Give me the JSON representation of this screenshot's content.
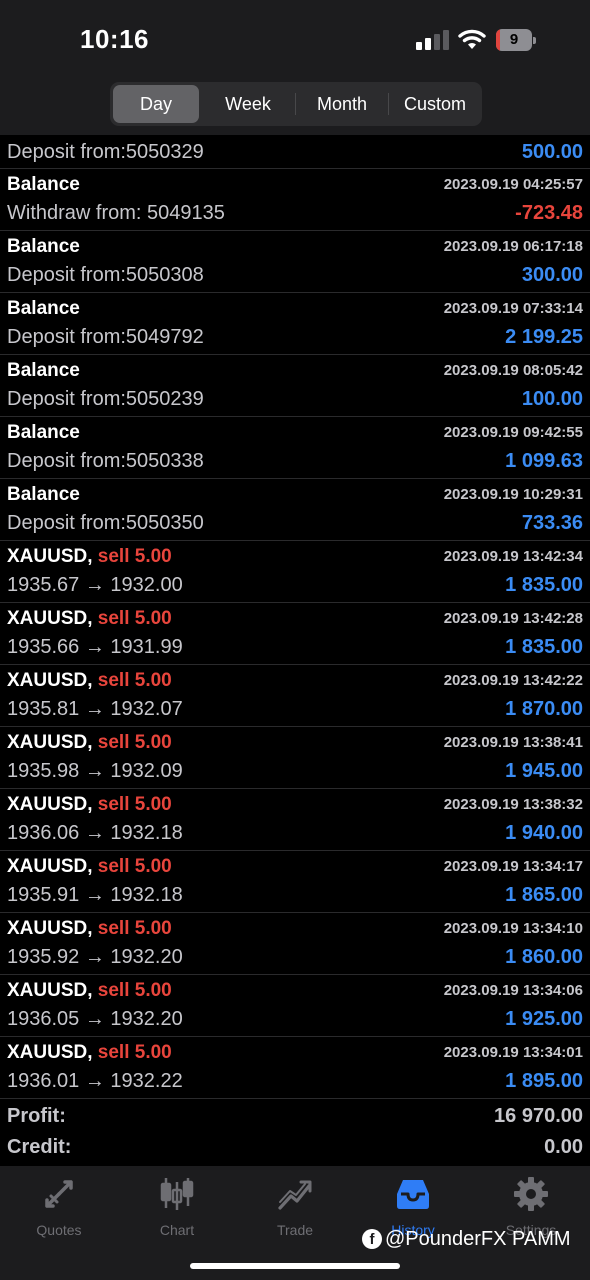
{
  "status_bar": {
    "time": "10:16",
    "battery_level": "9",
    "battery_fraction": 0.09
  },
  "period_tabs": [
    {
      "label": "Day",
      "active": true
    },
    {
      "label": "Week",
      "active": false
    },
    {
      "label": "Month",
      "active": false
    },
    {
      "label": "Custom",
      "active": false
    }
  ],
  "history": {
    "partial_row": {
      "comment": "Deposit from:5050329",
      "amount": "500.00"
    },
    "rows": [
      {
        "title": "Balance",
        "time": "2023.09.19 04:25:57",
        "comment": "Withdraw from: 5049135",
        "amount": "-723.48",
        "negative": true
      },
      {
        "title": "Balance",
        "time": "2023.09.19 06:17:18",
        "comment": "Deposit from:5050308",
        "amount": "300.00"
      },
      {
        "title": "Balance",
        "time": "2023.09.19 07:33:14",
        "comment": "Deposit from:5049792",
        "amount": "2 199.25"
      },
      {
        "title": "Balance",
        "time": "2023.09.19 08:05:42",
        "comment": "Deposit from:5050239",
        "amount": "100.00"
      },
      {
        "title": "Balance",
        "time": "2023.09.19 09:42:55",
        "comment": "Deposit from:5050338",
        "amount": "1 099.63"
      },
      {
        "title": "Balance",
        "time": "2023.09.19 10:29:31",
        "comment": "Deposit from:5050350",
        "amount": "733.36"
      },
      {
        "symbol": "XAUUSD,",
        "side": "sell 5.00",
        "time": "2023.09.19 13:42:34",
        "comment": "1935.67 → 1932.00",
        "amount": "1 835.00"
      },
      {
        "symbol": "XAUUSD,",
        "side": "sell 5.00",
        "time": "2023.09.19 13:42:28",
        "comment": "1935.66 → 1931.99",
        "amount": "1 835.00"
      },
      {
        "symbol": "XAUUSD,",
        "side": "sell 5.00",
        "time": "2023.09.19 13:42:22",
        "comment": "1935.81 → 1932.07",
        "amount": "1 870.00"
      },
      {
        "symbol": "XAUUSD,",
        "side": "sell 5.00",
        "time": "2023.09.19 13:38:41",
        "comment": "1935.98 → 1932.09",
        "amount": "1 945.00"
      },
      {
        "symbol": "XAUUSD,",
        "side": "sell 5.00",
        "time": "2023.09.19 13:38:32",
        "comment": "1936.06 → 1932.18",
        "amount": "1 940.00"
      },
      {
        "symbol": "XAUUSD,",
        "side": "sell 5.00",
        "time": "2023.09.19 13:34:17",
        "comment": "1935.91 → 1932.18",
        "amount": "1 865.00"
      },
      {
        "symbol": "XAUUSD,",
        "side": "sell 5.00",
        "time": "2023.09.19 13:34:10",
        "comment": "1935.92 → 1932.20",
        "amount": "1 860.00"
      },
      {
        "symbol": "XAUUSD,",
        "side": "sell 5.00",
        "time": "2023.09.19 13:34:06",
        "comment": "1936.05 → 1932.20",
        "amount": "1 925.00"
      },
      {
        "symbol": "XAUUSD,",
        "side": "sell 5.00",
        "time": "2023.09.19 13:34:01",
        "comment": "1936.01 → 1932.22",
        "amount": "1 895.00"
      }
    ]
  },
  "totals": {
    "profit_label": "Profit:",
    "profit_value": "16 970.00",
    "credit_label": "Credit:",
    "credit_value": "0.00"
  },
  "tab_bar": [
    {
      "label": "Quotes",
      "icon": "quotes-arrows-icon",
      "active": false
    },
    {
      "label": "Chart",
      "icon": "candlestick-chart-icon",
      "active": false
    },
    {
      "label": "Trade",
      "icon": "trade-trend-icon",
      "active": false
    },
    {
      "label": "History",
      "icon": "history-inbox-icon",
      "active": true
    },
    {
      "label": "Settings",
      "icon": "gear-icon",
      "active": false
    }
  ],
  "watermark": {
    "text": "@PounderFX PAMM",
    "icon": "facebook-icon"
  },
  "colors": {
    "positive": "#3b8cf4",
    "negative": "#e8453c",
    "active_tab": "#2f7df6",
    "bar_bg": "#1c1c1e"
  }
}
